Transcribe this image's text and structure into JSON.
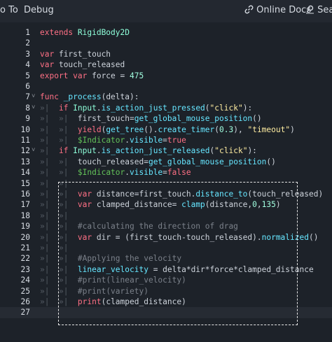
{
  "menubar": {
    "goto": "o To",
    "debug": "Debug",
    "online_docs": "Online Docs",
    "search": "Sear"
  },
  "icons": {
    "online_docs": "link-icon",
    "search": "search-help-icon"
  },
  "colors": {
    "keyword": "#ff7085",
    "function": "#66e6ff",
    "type": "#8effda",
    "number": "#a1ffe0",
    "string": "#ffeda1",
    "node_path": "#63c259",
    "comment": "#7b818a",
    "text": "#cdd3db"
  },
  "editor": {
    "current_line": 27,
    "lines": [
      {
        "n": "1",
        "fold": "",
        "indent": [],
        "tokens": [
          [
            "kw",
            "extends "
          ],
          [
            "ty",
            "RigidBody2D"
          ]
        ]
      },
      {
        "n": "2",
        "fold": "",
        "indent": [],
        "tokens": []
      },
      {
        "n": "3",
        "fold": "",
        "indent": [],
        "tokens": [
          [
            "kw",
            "var "
          ],
          [
            "t",
            "first_touch"
          ]
        ]
      },
      {
        "n": "4",
        "fold": "",
        "indent": [],
        "tokens": [
          [
            "kw",
            "var "
          ],
          [
            "t",
            "touch_released"
          ]
        ]
      },
      {
        "n": "5",
        "fold": "",
        "indent": [],
        "tokens": [
          [
            "kw",
            "export var "
          ],
          [
            "t",
            "force = "
          ],
          [
            "num",
            "475"
          ]
        ]
      },
      {
        "n": "6",
        "fold": "",
        "indent": [],
        "tokens": []
      },
      {
        "n": "7",
        "fold": "v",
        "indent": [],
        "tokens": [
          [
            "kw",
            "func "
          ],
          [
            "fn",
            "_process"
          ],
          [
            "t",
            "(delta):"
          ]
        ]
      },
      {
        "n": "8",
        "fold": "v",
        "indent": [
          ">|"
        ],
        "tokens": [
          [
            "kw",
            "if "
          ],
          [
            "ty",
            "Input"
          ],
          [
            "t",
            "."
          ],
          [
            "fn",
            "is_action_just_pressed"
          ],
          [
            "t",
            "("
          ],
          [
            "str",
            "\"click\""
          ],
          [
            "t",
            "):"
          ]
        ]
      },
      {
        "n": "9",
        "fold": "",
        "indent": [
          ">|",
          ">|"
        ],
        "tokens": [
          [
            "t",
            "first_touch="
          ],
          [
            "fn",
            "get_global_mouse_position"
          ],
          [
            "t",
            "()"
          ]
        ]
      },
      {
        "n": "10",
        "fold": "",
        "indent": [
          ">|",
          ">|"
        ],
        "tokens": [
          [
            "kw",
            "yield"
          ],
          [
            "t",
            "("
          ],
          [
            "fn",
            "get_tree"
          ],
          [
            "t",
            "()."
          ],
          [
            "fn",
            "create_timer"
          ],
          [
            "t",
            "("
          ],
          [
            "num",
            "0.3"
          ],
          [
            "t",
            "), "
          ],
          [
            "str",
            "\"timeout\""
          ],
          [
            "t",
            ")"
          ]
        ]
      },
      {
        "n": "11",
        "fold": "",
        "indent": [
          ">|",
          ">|"
        ],
        "tokens": [
          [
            "nd",
            "$Indicator"
          ],
          [
            "t",
            "."
          ],
          [
            "fn",
            "visible"
          ],
          [
            "t",
            "="
          ],
          [
            "kw",
            "true"
          ]
        ]
      },
      {
        "n": "12",
        "fold": "v",
        "indent": [
          ">|"
        ],
        "tokens": [
          [
            "kw",
            "if "
          ],
          [
            "ty",
            "Input"
          ],
          [
            "t",
            "."
          ],
          [
            "fn",
            "is_action_just_released"
          ],
          [
            "t",
            "("
          ],
          [
            "str",
            "\"click\""
          ],
          [
            "t",
            "):"
          ]
        ]
      },
      {
        "n": "13",
        "fold": "",
        "indent": [
          ">|",
          ">|"
        ],
        "tokens": [
          [
            "t",
            "touch_released="
          ],
          [
            "fn",
            "get_global_mouse_position"
          ],
          [
            "t",
            "()"
          ]
        ]
      },
      {
        "n": "14",
        "fold": "",
        "indent": [
          ">|",
          ">|"
        ],
        "tokens": [
          [
            "nd",
            "$Indicator"
          ],
          [
            "t",
            "."
          ],
          [
            "fn",
            "visible"
          ],
          [
            "t",
            "="
          ],
          [
            "kw",
            "false"
          ]
        ]
      },
      {
        "n": "15",
        "fold": "",
        "indent": [
          ">|",
          ">|"
        ],
        "tokens": []
      },
      {
        "n": "16",
        "fold": "",
        "indent": [
          ">|",
          ">|"
        ],
        "tokens": [
          [
            "kw",
            "var "
          ],
          [
            "t",
            "distance=first_touch."
          ],
          [
            "fn",
            "distance_to"
          ],
          [
            "t",
            "(touch_released)"
          ]
        ]
      },
      {
        "n": "17",
        "fold": "",
        "indent": [
          ">|",
          ">|"
        ],
        "tokens": [
          [
            "kw",
            "var "
          ],
          [
            "t",
            "clamped_distance= "
          ],
          [
            "fn",
            "clamp"
          ],
          [
            "t",
            "(distance,"
          ],
          [
            "num",
            "0"
          ],
          [
            "t",
            ","
          ],
          [
            "num",
            "135"
          ],
          [
            "t",
            ")"
          ]
        ]
      },
      {
        "n": "18",
        "fold": "",
        "indent": [
          ">|",
          ">|"
        ],
        "tokens": []
      },
      {
        "n": "19",
        "fold": "",
        "indent": [
          ">|",
          ">|"
        ],
        "tokens": [
          [
            "cm",
            "#calculating the direction of drag"
          ]
        ]
      },
      {
        "n": "20",
        "fold": "",
        "indent": [
          ">|",
          ">|"
        ],
        "tokens": [
          [
            "kw",
            "var "
          ],
          [
            "t",
            "dir = (first_touch-touch_released)."
          ],
          [
            "fn",
            "normalized"
          ],
          [
            "t",
            "()"
          ]
        ]
      },
      {
        "n": "21",
        "fold": "",
        "indent": [
          ">|",
          ">|"
        ],
        "tokens": []
      },
      {
        "n": "22",
        "fold": "",
        "indent": [
          ">|",
          ">|"
        ],
        "tokens": [
          [
            "cm",
            "#Applying the velocity"
          ]
        ]
      },
      {
        "n": "23",
        "fold": "",
        "indent": [
          ">|",
          ">|"
        ],
        "tokens": [
          [
            "fn",
            "linear_velocity"
          ],
          [
            "t",
            " = delta*dir*force*clamped_distance"
          ]
        ]
      },
      {
        "n": "24",
        "fold": "",
        "indent": [
          ">|",
          ">|"
        ],
        "tokens": [
          [
            "cm",
            "#print(linear_velocity)"
          ]
        ]
      },
      {
        "n": "25",
        "fold": "",
        "indent": [
          ">|",
          ">|"
        ],
        "tokens": [
          [
            "cm",
            "#print(variety)"
          ]
        ]
      },
      {
        "n": "26",
        "fold": "",
        "indent": [
          ">|",
          ">|"
        ],
        "tokens": [
          [
            "kw",
            "print"
          ],
          [
            "t",
            "(clamped_distance)"
          ]
        ]
      },
      {
        "n": "27",
        "fold": "",
        "indent": [],
        "tokens": []
      }
    ]
  }
}
